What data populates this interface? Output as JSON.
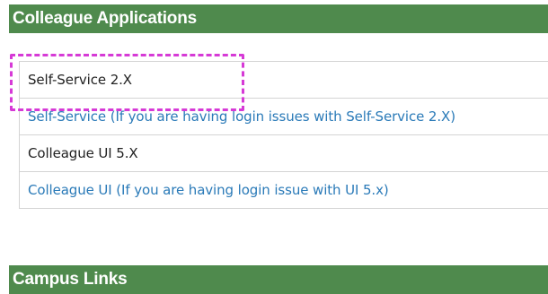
{
  "sections": {
    "apps_title": "Colleague Applications",
    "campus_title": "Campus Links"
  },
  "links": [
    {
      "label": "Self-Service 2.X",
      "color": "#222222"
    },
    {
      "label": "Self-Service (If you are having login issues with Self-Service 2.X)",
      "color": "#2a7ab8"
    },
    {
      "label": "Colleague UI 5.X",
      "color": "#222222"
    },
    {
      "label": "Colleague UI (If you are having login issue with UI 5.x)",
      "color": "#2a7ab8"
    }
  ],
  "colors": {
    "header_bg": "#4f8a4d",
    "highlight": "#d63ad6"
  }
}
